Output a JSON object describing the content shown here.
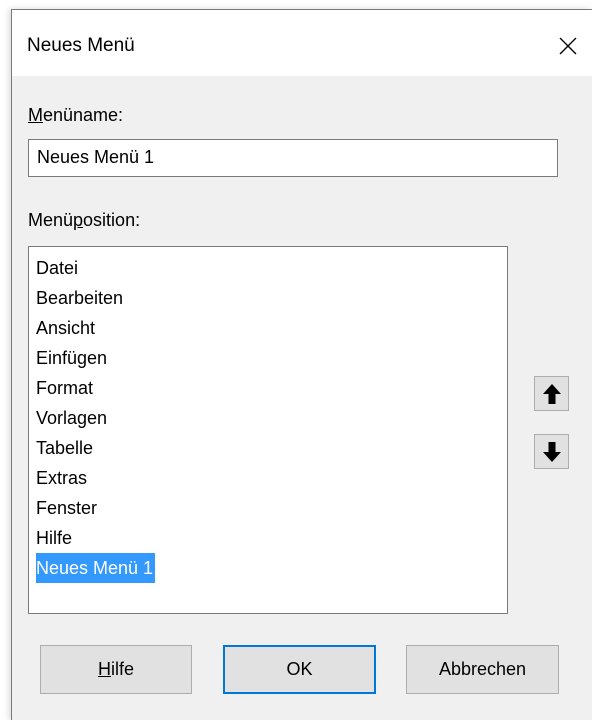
{
  "window": {
    "title": "Neues Menü"
  },
  "menu_name": {
    "label_mnemonic": "M",
    "label_rest": "enüname:",
    "value": "Neues Menü 1"
  },
  "menu_position": {
    "label_before": "Menü",
    "label_mnemonic": "p",
    "label_after": "osition:",
    "items": [
      "Datei",
      "Bearbeiten",
      "Ansicht",
      "Einfügen",
      "Format",
      "Vorlagen",
      "Tabelle",
      "Extras",
      "Fenster",
      "Hilfe",
      "Neues Menü 1"
    ],
    "selected_index": 10
  },
  "icons": {
    "close": "close-icon",
    "move_up": "arrow-up-icon",
    "move_down": "arrow-down-icon"
  },
  "buttons": {
    "help_mnemonic": "H",
    "help_rest": "ilfe",
    "ok": "OK",
    "cancel": "Abbrechen"
  },
  "colors": {
    "selection": "#3399ff",
    "default_button_border": "#0078d7",
    "dialog_background": "#f0f0f0"
  }
}
